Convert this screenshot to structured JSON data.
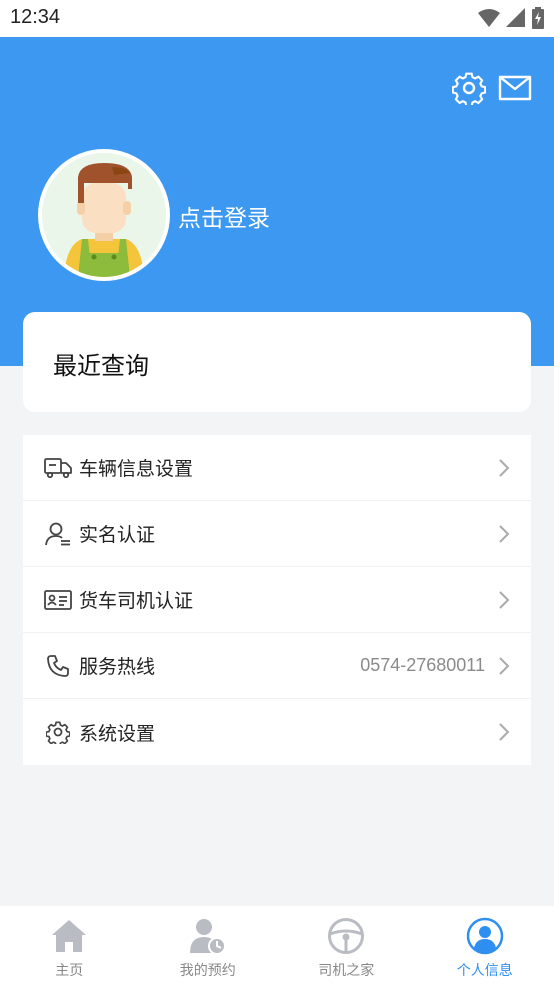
{
  "status_bar": {
    "time": "12:34"
  },
  "header": {
    "login_text": "点击登录"
  },
  "recent": {
    "title": "最近查询"
  },
  "menu": {
    "items": [
      {
        "label": "车辆信息设置",
        "value": ""
      },
      {
        "label": "实名认证",
        "value": ""
      },
      {
        "label": "货车司机认证",
        "value": ""
      },
      {
        "label": "服务热线",
        "value": "0574-27680011"
      },
      {
        "label": "系统设置",
        "value": ""
      }
    ]
  },
  "tabbar": {
    "items": [
      {
        "label": "主页",
        "icon": "home-icon"
      },
      {
        "label": "我的预约",
        "icon": "appointment-icon"
      },
      {
        "label": "司机之家",
        "icon": "steering-wheel-icon"
      },
      {
        "label": "个人信息",
        "icon": "profile-icon"
      }
    ],
    "active_index": 3
  },
  "colors": {
    "primary": "#3d98f2",
    "active_tab": "#2f8ff0",
    "background": "#f3f4f6"
  }
}
